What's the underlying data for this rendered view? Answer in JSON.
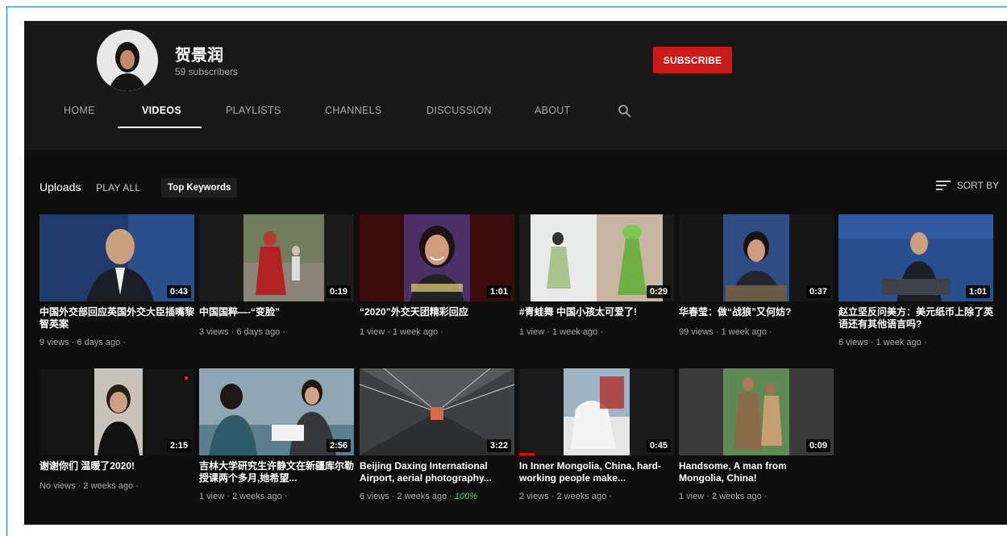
{
  "channel": {
    "name": "贺景润",
    "subscribers": "59 subscribers",
    "subscribe_label": "SUBSCRIBE"
  },
  "tabs": [
    {
      "label": "HOME"
    },
    {
      "label": "VIDEOS"
    },
    {
      "label": "PLAYLISTS"
    },
    {
      "label": "CHANNELS"
    },
    {
      "label": "DISCUSSION"
    },
    {
      "label": "ABOUT"
    }
  ],
  "active_tab": "VIDEOS",
  "uploads": {
    "title": "Uploads",
    "play_all": "PLAY ALL",
    "keywords_chip": "Top Keywords",
    "sort_label": "SORT BY"
  },
  "colors": {
    "accent": "#cc1a1a",
    "background": "#0f0f0f",
    "header": "#181818"
  },
  "videos": [
    {
      "title": "中国外交部回应英国外交大臣插嘴黎智英案",
      "duration": "0:43",
      "meta": "9 views · 6 days ago ·"
    },
    {
      "title": "中国国粹—-“变脸”",
      "duration": "0:19",
      "meta": "3 views · 6 days ago ·"
    },
    {
      "title": "“2020”外交天团精彩回应",
      "duration": "1:01",
      "meta": "1 view · 1 week ago ·"
    },
    {
      "title": "#青蛙舞 中国小孩太可爱了!",
      "duration": "0:29",
      "meta": "1 view · 1 week ago ·"
    },
    {
      "title": "华春莹：做“战狼”又何妨?",
      "duration": "0:37",
      "meta": "99 views · 1 week ago ·"
    },
    {
      "title": "赵立坚反问美方：美元纸币上除了英语还有其他语言吗?",
      "duration": "1:01",
      "meta": "6 views · 1 week ago ·"
    },
    {
      "title": "谢谢你们 温暖了2020!",
      "duration": "2:15",
      "meta": "No views · 2 weeks ago ·"
    },
    {
      "title": "吉林大学研究生许静文在新疆库尔勒授课两个多月,她希望...",
      "duration": "2:56",
      "meta": "1 view · 2 weeks ago ·"
    },
    {
      "title": "Beijing Daxing International Airport, aerial photography...",
      "duration": "3:22",
      "meta": "6 views · 2 weeks ago ·",
      "extra": "100%"
    },
    {
      "title": "In Inner Mongolia, China, hard-working people make...",
      "duration": "0:45",
      "meta": "2 views · 2 weeks ago ·",
      "progress": 0.1
    },
    {
      "title": "Handsome, A man from Mongolia, China!",
      "duration": "0:09",
      "meta": "1 view · 2 weeks ago ·"
    }
  ]
}
